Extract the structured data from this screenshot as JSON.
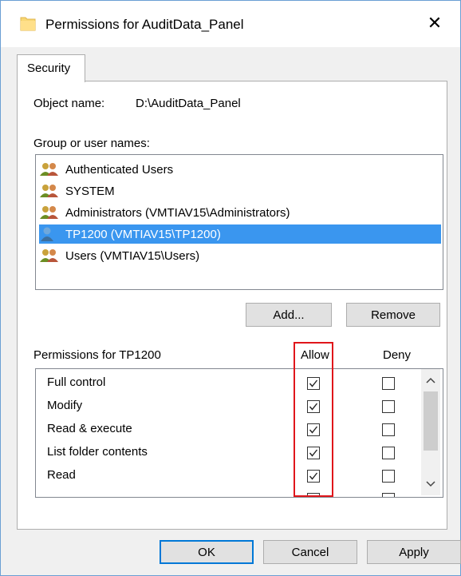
{
  "window": {
    "title": "Permissions for AuditData_Panel",
    "close_glyph": "✕"
  },
  "tabs": [
    {
      "label": "Security"
    }
  ],
  "object": {
    "label": "Object name:",
    "value": "D:\\AuditData_Panel"
  },
  "groups": {
    "label": "Group or user names:",
    "items": [
      {
        "label": "Authenticated Users",
        "icon": "group-users-icon",
        "selected": false
      },
      {
        "label": "SYSTEM",
        "icon": "group-users-icon",
        "selected": false
      },
      {
        "label": "Administrators (VMTIAV15\\Administrators)",
        "icon": "group-users-icon",
        "selected": false
      },
      {
        "label": "TP1200 (VMTIAV15\\TP1200)",
        "icon": "single-user-icon",
        "selected": true
      },
      {
        "label": "Users (VMTIAV15\\Users)",
        "icon": "group-users-icon",
        "selected": false
      }
    ]
  },
  "buttons": {
    "add": "Add...",
    "remove": "Remove",
    "ok": "OK",
    "cancel": "Cancel",
    "apply": "Apply"
  },
  "permissions": {
    "label": "Permissions for TP1200",
    "allow_header": "Allow",
    "deny_header": "Deny",
    "rows": [
      {
        "name": "Full control",
        "allow": true,
        "deny": false
      },
      {
        "name": "Modify",
        "allow": true,
        "deny": false
      },
      {
        "name": "Read & execute",
        "allow": true,
        "deny": false
      },
      {
        "name": "List folder contents",
        "allow": true,
        "deny": false
      },
      {
        "name": "Read",
        "allow": true,
        "deny": false
      }
    ]
  },
  "colors": {
    "selection": "#3a96ef",
    "highlight_box": "#e0161b",
    "default_button_border": "#0078d7"
  }
}
